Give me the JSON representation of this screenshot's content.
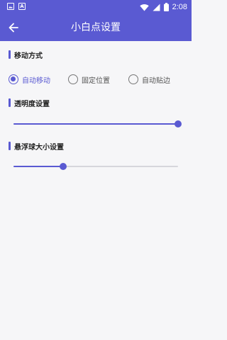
{
  "status_bar": {
    "time": "2:08",
    "icons": [
      "image-icon",
      "text-a-icon",
      "wifi-icon",
      "signal-icon",
      "battery-icon"
    ],
    "a_glyph": "A"
  },
  "app_bar": {
    "title": "小白点设置",
    "back_icon": "arrow-left-icon"
  },
  "colors": {
    "accent": "#5a5ad2",
    "background": "#f6f6f8",
    "track": "#d6d6dc"
  },
  "move_mode": {
    "title": "移动方式",
    "options": [
      {
        "label": "自动移动",
        "checked": true
      },
      {
        "label": "固定位置",
        "checked": false
      },
      {
        "label": "自动贴边",
        "checked": false
      }
    ]
  },
  "transparency": {
    "title": "透明度设置",
    "value_fraction": 1.0
  },
  "ball_size": {
    "title": "悬浮球大小设置",
    "value_fraction": 0.3
  }
}
